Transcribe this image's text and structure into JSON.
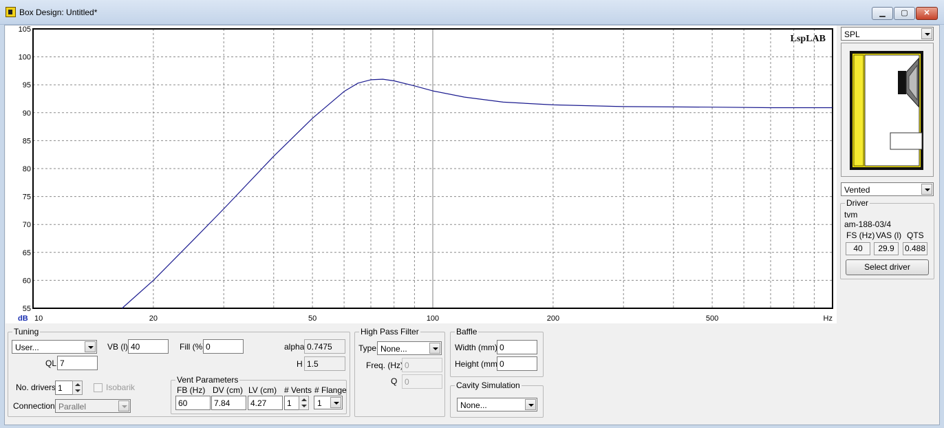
{
  "window": {
    "title": "Box Design: Untitled*"
  },
  "chart_data": {
    "type": "line",
    "x_scale": "log",
    "xlim": [
      10,
      1000
    ],
    "ylim": [
      55,
      105
    ],
    "y_ticks": [
      105,
      100,
      95,
      90,
      85,
      80,
      75,
      70,
      65,
      60,
      55
    ],
    "x_tick_labels": [
      {
        "x": 10,
        "label": "10"
      },
      {
        "x": 20,
        "label": "20"
      },
      {
        "x": 50,
        "label": "50"
      },
      {
        "x": 100,
        "label": "100"
      },
      {
        "x": 200,
        "label": "200"
      },
      {
        "x": 500,
        "label": "500"
      }
    ],
    "ylabel": "dB",
    "xlabel": "Hz",
    "watermark": "LspLAB",
    "grid": true,
    "series": [
      {
        "color": "#1b1b8f",
        "x": [
          16.7,
          20,
          25,
          30,
          40,
          50,
          60,
          65,
          70,
          75,
          80,
          90,
          100,
          120,
          150,
          200,
          300,
          500,
          700,
          1000
        ],
        "y": [
          55.0,
          60.0,
          67.0,
          72.8,
          82.2,
          89.0,
          93.8,
          95.3,
          95.9,
          96.0,
          95.7,
          94.8,
          93.9,
          92.8,
          91.9,
          91.4,
          91.1,
          91.0,
          90.9,
          90.9
        ]
      }
    ]
  },
  "right_panel": {
    "graph_select": "SPL",
    "box_type_select": "Vented",
    "driver": {
      "group_label": "Driver",
      "maker": "tvm",
      "model": "am-188-03/4",
      "headers": [
        "FS (Hz)",
        "VAS (l)",
        "QTS"
      ],
      "values": [
        "40",
        "29.9",
        "0.488"
      ],
      "select_button": "Select driver"
    }
  },
  "tuning": {
    "group_label": "Tuning",
    "preset": "User...",
    "vb_label": "VB (l)",
    "vb": "40",
    "fill_label": "Fill (%)",
    "fill": "0",
    "alpha_label": "alpha",
    "alpha": "0.7475",
    "ql_label": "QL",
    "ql": "7",
    "h_label": "H",
    "h": "1.5",
    "drivers_label": "No. drivers",
    "drivers": "1",
    "isobarik_label": "Isobarik",
    "connection_label": "Connection",
    "connection": "Parallel"
  },
  "vent": {
    "group_label": "Vent Parameters",
    "fb_label": "FB (Hz)",
    "fb": "60",
    "dv_label": "DV (cm)",
    "dv": "7.84",
    "lv_label": "LV (cm)",
    "lv": "4.27",
    "vents_label": "# Vents",
    "vents": "1",
    "flange_label": "# Flange",
    "flange": "1"
  },
  "hpf": {
    "group_label": "High Pass Filter",
    "type_label": "Type",
    "type": "None...",
    "freq_label": "Freq. (Hz)",
    "freq": "0",
    "q_label": "Q",
    "q": "0"
  },
  "baffle": {
    "group_label": "Baffle",
    "width_label": "Width (mm)",
    "width": "0",
    "height_label": "Height (mm)",
    "height": "0"
  },
  "cavity": {
    "group_label": "Cavity Simulation",
    "type": "None..."
  }
}
